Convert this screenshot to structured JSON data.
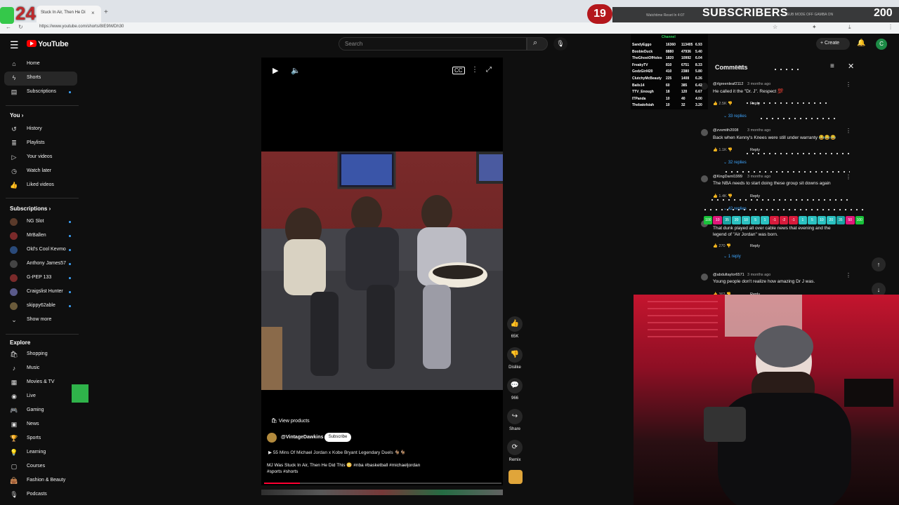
{
  "browser": {
    "tab_title": "Stuck In Air, Then He Di",
    "tab_close": "×",
    "tab_new": "+",
    "url": "https://www.youtube.com/shorts/8IE9IWDh30"
  },
  "stream": {
    "number_badge": "24",
    "red_badge": "19",
    "subscribers_label": "SUBSCRIBERS",
    "subscribers_count": "200",
    "watchtime_text": "Watchtime Reset In 4:07",
    "submode_text": "SUB MODE OFF   GAMBA ON"
  },
  "youtube": {
    "logo": "YouTube",
    "search_placeholder": "Search",
    "create_label": "Create",
    "avatar_letter": "C"
  },
  "sidebar": {
    "main": [
      {
        "label": "Home",
        "icon": "home-icon"
      },
      {
        "label": "Shorts",
        "icon": "shorts-icon"
      },
      {
        "label": "Subscriptions",
        "icon": "subscriptions-icon"
      }
    ],
    "you_header": "You",
    "you": [
      {
        "label": "History",
        "icon": "history-icon"
      },
      {
        "label": "Playlists",
        "icon": "playlists-icon"
      },
      {
        "label": "Your videos",
        "icon": "your-videos-icon"
      },
      {
        "label": "Watch later",
        "icon": "watch-later-icon"
      },
      {
        "label": "Liked videos",
        "icon": "liked-videos-icon"
      }
    ],
    "subs_header": "Subscriptions",
    "subs": [
      {
        "label": "NG Slot",
        "color": "#5a3a2a"
      },
      {
        "label": "MrBallen",
        "color": "#7a2a2a"
      },
      {
        "label": "Old's Cool Kevmo",
        "color": "#2a4a7a"
      },
      {
        "label": "Anthony James57",
        "color": "#444444"
      },
      {
        "label": "G-PEP 133",
        "color": "#7a2a2a"
      },
      {
        "label": "Craigslist Hunter",
        "color": "#5a5a8a"
      },
      {
        "label": "skippy62able",
        "color": "#6a5a3a"
      }
    ],
    "show_more": "Show more",
    "explore_header": "Explore",
    "explore": [
      {
        "label": "Shopping",
        "icon": "shopping-icon"
      },
      {
        "label": "Music",
        "icon": "music-icon"
      },
      {
        "label": "Movies & TV",
        "icon": "movies-icon"
      },
      {
        "label": "Live",
        "icon": "live-icon"
      },
      {
        "label": "Gaming",
        "icon": "gaming-icon"
      },
      {
        "label": "News",
        "icon": "news-icon"
      },
      {
        "label": "Sports",
        "icon": "sports-icon"
      },
      {
        "label": "Learning",
        "icon": "learning-icon"
      },
      {
        "label": "Courses",
        "icon": "courses-icon"
      },
      {
        "label": "Fashion & Beauty",
        "icon": "fashion-icon"
      },
      {
        "label": "Podcasts",
        "icon": "podcasts-icon"
      }
    ]
  },
  "video": {
    "view_products": "View products",
    "channel": "@VintageDawkins",
    "subscribe": "Subscribe",
    "playlist": "55 Mins Of Michael Jordan x Kobe Bryant Legendary Duels 🐐🐐",
    "description_line1": "MJ Was Stuck In Air, Then He Did This 😳 #nba #basketball #michaeljordan",
    "description_line2": "#sports #shorts",
    "progress_fraction": 0.15
  },
  "actions": {
    "likes": "65K",
    "dislike": "Dislike",
    "comments": "966",
    "share": "Share",
    "remix": "Remix"
  },
  "comments": {
    "title": "Comments",
    "count": "966",
    "items": [
      {
        "user": "@rlgreenleaf2112",
        "time": "3 months ago",
        "text": "He called it the \"Dr. J\". Respect 💯",
        "likes": "2.5K",
        "reply": "Reply",
        "replies": "33 replies"
      },
      {
        "user": "@zvsmith2008",
        "time": "3 months ago",
        "text": "Back when Kenny's Knees were still under warranty 😂😂😂",
        "likes": "1.1K",
        "reply": "Reply",
        "replies": "32 replies"
      },
      {
        "user": "@KingDarnl1999",
        "time": "3 months ago",
        "text": "The NBA needs to start doing these group sit downs again",
        "likes": "1.4K",
        "reply": "Reply",
        "replies": "42 replies"
      },
      {
        "user": "",
        "time": "",
        "text": "That dunk played all over cable news that evening and the",
        "text2": "legend of \"Air Jordan\" was born.",
        "likes": "270",
        "reply": "Reply",
        "replies": "1 reply"
      },
      {
        "user": "@abdultaylor6571",
        "time": "3 months ago",
        "text": "Young people don't realize how amazing Dr J was.",
        "likes": "362",
        "reply": "Reply",
        "replies": ""
      }
    ]
  },
  "stats": {
    "title": "Channel",
    "rows": [
      [
        "SandyEggo",
        "16360",
        "113405",
        "6.93"
      ],
      [
        "BoobieDuck",
        "8880",
        "47936",
        "5.40"
      ],
      [
        "TheGhostOfHoles",
        "1820",
        "10992",
        "6.04"
      ],
      [
        "FreakyTV",
        "810",
        "6751",
        "8.33"
      ],
      [
        "GodzGirl420",
        "410",
        "2380",
        "5.80"
      ],
      [
        "ClutchyMcBeauty",
        "225",
        "1408",
        "6.26"
      ],
      [
        "Bails14",
        "60",
        "385",
        "6.42"
      ],
      [
        "TTV_Enough",
        "18",
        "120",
        "6.67"
      ],
      [
        "ITPanda",
        "10",
        "40",
        "4.00"
      ],
      [
        "Thebatofsiah",
        "10",
        "32",
        "3.20"
      ]
    ]
  },
  "vote_bar": [
    {
      "v": "100",
      "c": "#19c23a"
    },
    {
      "v": "10",
      "c": "#e0177a"
    },
    {
      "v": "35",
      "c": "#1aa3a3"
    },
    {
      "v": "20",
      "c": "#2bc1c1"
    },
    {
      "v": "10",
      "c": "#2bc1c1"
    },
    {
      "v": "5",
      "c": "#2bc1c1"
    },
    {
      "v": "1",
      "c": "#2bc1c1"
    },
    {
      "v": "-1",
      "c": "#d81b3c"
    },
    {
      "v": "-2",
      "c": "#d81b3c"
    },
    {
      "v": "-1",
      "c": "#d81b3c"
    },
    {
      "v": "1",
      "c": "#2bc1c1"
    },
    {
      "v": "5",
      "c": "#2bc1c1"
    },
    {
      "v": "10",
      "c": "#2bc1c1"
    },
    {
      "v": "20",
      "c": "#2bc1c1"
    },
    {
      "v": "35",
      "c": "#1aa3a3"
    },
    {
      "v": "50",
      "c": "#e0177a"
    },
    {
      "v": "100",
      "c": "#19c23a"
    }
  ]
}
